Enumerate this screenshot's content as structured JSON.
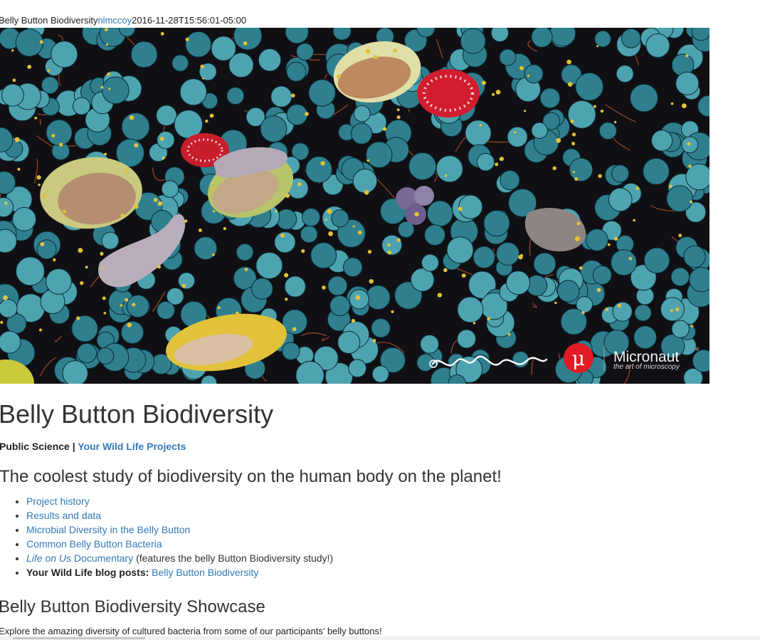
{
  "meta": {
    "title": "Belly Button Biodiversity",
    "author": "nlmccoy",
    "timestamp": "2016-11-28T15:56:01-05:00"
  },
  "hero": {
    "brand_symbol": "μ",
    "brand_name": "Micronaut",
    "brand_mark": "®",
    "brand_tagline": "the art of microscopy",
    "colors": {
      "background": "#101014",
      "cocci": "#2f7f8f",
      "cocci_highlight": "#4ea3b0",
      "rod_green": "#b8c24a",
      "rod_yellow": "#e2c23a",
      "filament": "#c8522b",
      "red_cell": "#d21d2f",
      "logo_red": "#e01b24"
    }
  },
  "article": {
    "title": "Belly Button Biodiversity",
    "byline_label": "Public Science",
    "byline_separator": " | ",
    "byline_link": "Your Wild Life Projects",
    "subtitle": "The coolest study of biodiversity on the human body on the planet!",
    "links": [
      {
        "text": "Project history"
      },
      {
        "text": "Results and data"
      },
      {
        "text": "Microbial Diversity in the Belly Button"
      },
      {
        "text": "Common Belly Button Bacteria"
      },
      {
        "italic": "Life on Us",
        "text": " Documentary",
        "suffix": " (features the belly Button Biodiversity study!)"
      },
      {
        "label": "Your Wild Life blog posts:",
        "text": "Belly Button Biodiversity"
      }
    ],
    "showcase_title": "Belly Button Biodiversity Showcase",
    "showcase_text": "Explore the amazing diversity of cultured bacteria from some of our participants’ belly buttons!"
  }
}
